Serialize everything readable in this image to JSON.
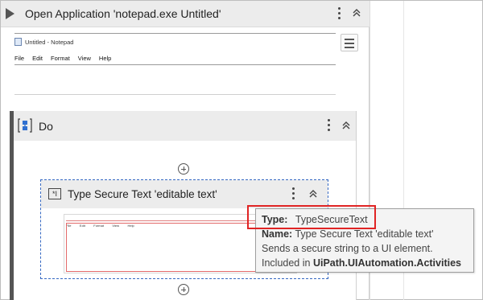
{
  "open_application": {
    "title": "Open Application 'notepad.exe Untitled'",
    "preview": {
      "window_title": "Untitled - Notepad",
      "menu": [
        "File",
        "Edit",
        "Format",
        "View",
        "Help"
      ]
    }
  },
  "do_sequence": {
    "title": "Do"
  },
  "type_secure_text": {
    "title": "Type Secure Text 'editable text'",
    "thumb_menu": [
      "File",
      "Edit",
      "Format",
      "View",
      "Help"
    ]
  },
  "tooltip": {
    "type_label": "Type:",
    "type_value": "TypeSecureText",
    "name_label": "Name:",
    "name_value": "Type Secure Text 'editable text'",
    "description": "Sends a secure string to a UI element.",
    "included_in_label": "Included in",
    "included_in_value": "UiPath.UIAutomation.Activities"
  },
  "colors": {
    "highlight_border": "#e02424",
    "selection_border": "#3568c2",
    "header_bg": "#ececec"
  },
  "icons": [
    "play-icon",
    "kebab-menu-icon",
    "collapse-chevron-icon",
    "hamburger-icon",
    "sequence-icon",
    "add-activity-icon",
    "secure-text-icon"
  ]
}
